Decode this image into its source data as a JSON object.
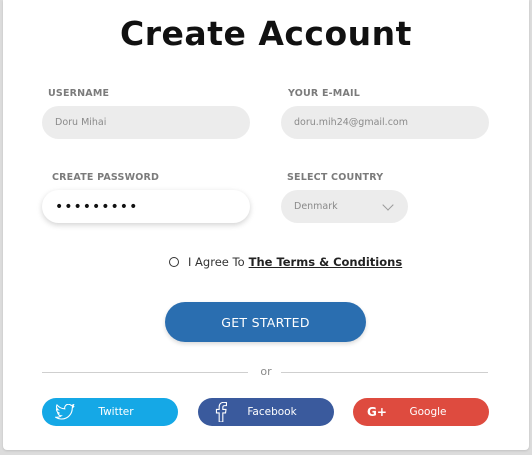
{
  "title": "Create Account",
  "form": {
    "username": {
      "label": "USERNAME",
      "value": "Doru Mihai"
    },
    "email": {
      "label": "YOUR E-MAIL",
      "value": "doru.mih24@gmail.com"
    },
    "password": {
      "label": "CREATE PASSWORD",
      "value": "•••••••••"
    },
    "country": {
      "label": "SELECT COUNTRY",
      "value": "Denmark"
    }
  },
  "agree": {
    "text": "I Agree To",
    "link": "The Terms & Conditions"
  },
  "cta": {
    "label": "GET STARTED"
  },
  "divider_text": "or",
  "social": {
    "twitter": {
      "label": "Twitter",
      "color": "#15a8e6"
    },
    "facebook": {
      "label": "Facebook",
      "color": "#3a5a9d"
    },
    "google": {
      "label": "Google",
      "color": "#de4b3f"
    }
  },
  "colors": {
    "primary": "#2a6eb0",
    "field_bg": "#ececec"
  }
}
